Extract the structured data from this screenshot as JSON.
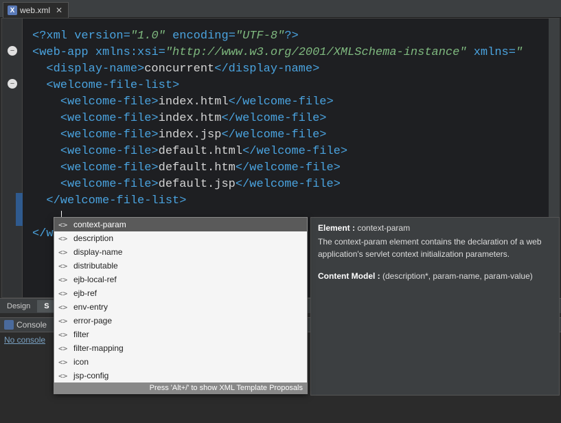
{
  "tab": {
    "filename": "web.xml",
    "icon_letter": "X"
  },
  "code": {
    "lines": [
      {
        "indent": 0,
        "html": "<span class='tk-pi'>&lt;?</span><span class='tk-tag'>xml</span> <span class='tk-attr'>version</span><span class='tk-tag'>=</span><span class='tk-str'>\"1.0\"</span> <span class='tk-attr'>encoding</span><span class='tk-tag'>=</span><span class='tk-str'>\"UTF-8\"</span><span class='tk-pi'>?&gt;</span>"
      },
      {
        "indent": 0,
        "html": "<span class='tk-tag'>&lt;web-app</span> <span class='tk-attr'>xmlns:xsi</span><span class='tk-tag'>=</span><span class='tk-str'>\"http://www.w3.org/2001/XMLSchema-instance\"</span> <span class='tk-attr'>xmlns</span><span class='tk-tag'>=</span><span class='tk-str'>\"</span>"
      },
      {
        "indent": 1,
        "html": "<span class='tk-tag'>&lt;display-name&gt;</span><span class='tk-text'>concurrent</span><span class='tk-tag'>&lt;/display-name&gt;</span>"
      },
      {
        "indent": 1,
        "html": "<span class='tk-tag'>&lt;welcome-file-list&gt;</span>"
      },
      {
        "indent": 2,
        "html": "<span class='tk-tag'>&lt;welcome-file&gt;</span><span class='tk-text'>index.html</span><span class='tk-tag'>&lt;/welcome-file&gt;</span>"
      },
      {
        "indent": 2,
        "html": "<span class='tk-tag'>&lt;welcome-file&gt;</span><span class='tk-text'>index.htm</span><span class='tk-tag'>&lt;/welcome-file&gt;</span>"
      },
      {
        "indent": 2,
        "html": "<span class='tk-tag'>&lt;welcome-file&gt;</span><span class='tk-text'>index.jsp</span><span class='tk-tag'>&lt;/welcome-file&gt;</span>"
      },
      {
        "indent": 2,
        "html": "<span class='tk-tag'>&lt;welcome-file&gt;</span><span class='tk-text'>default.html</span><span class='tk-tag'>&lt;/welcome-file&gt;</span>"
      },
      {
        "indent": 2,
        "html": "<span class='tk-tag'>&lt;welcome-file&gt;</span><span class='tk-text'>default.htm</span><span class='tk-tag'>&lt;/welcome-file&gt;</span>"
      },
      {
        "indent": 2,
        "html": "<span class='tk-tag'>&lt;welcome-file&gt;</span><span class='tk-text'>default.jsp</span><span class='tk-tag'>&lt;/welcome-file&gt;</span>"
      },
      {
        "indent": 1,
        "html": "<span class='tk-tag'>&lt;/welcome-file-list&gt;</span>"
      },
      {
        "indent": 1,
        "html": ""
      },
      {
        "indent": 0,
        "html": "<span class='tk-tag'>&lt;/w</span>"
      }
    ]
  },
  "autocomplete": {
    "items": [
      "context-param",
      "description",
      "display-name",
      "distributable",
      "ejb-local-ref",
      "ejb-ref",
      "env-entry",
      "error-page",
      "filter",
      "filter-mapping",
      "icon",
      "jsp-config"
    ],
    "selected_index": 0,
    "footer": "Press 'Alt+/' to show XML Template Proposals"
  },
  "doc": {
    "element_label": "Element :",
    "element_name": "context-param",
    "description": "The context-param element contains the declaration of a web application's servlet context initialization parameters.",
    "content_model_label": "Content Model :",
    "content_model": "(description*, param-name, param-value)"
  },
  "bottom_tabs": {
    "design": "Design",
    "source": "S"
  },
  "console": {
    "title": "Console",
    "message": "No console"
  }
}
